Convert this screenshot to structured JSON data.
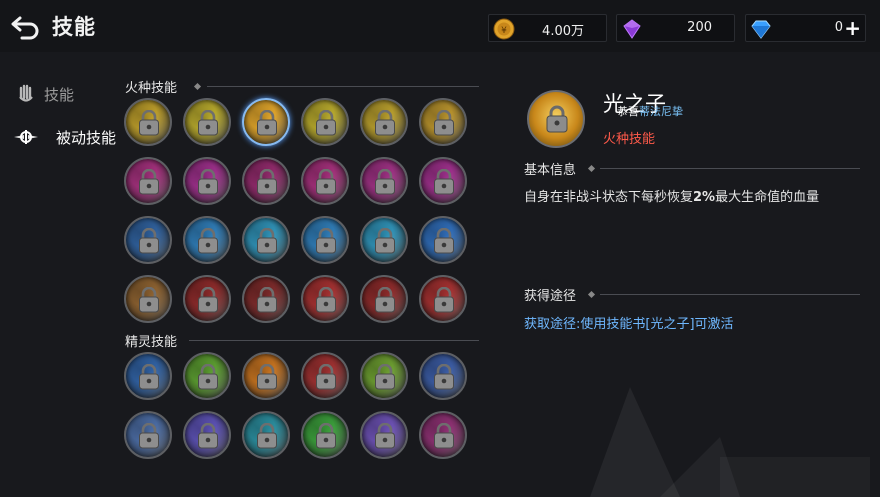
{
  "header": {
    "title": "技能"
  },
  "currencies": {
    "gold": {
      "value": "4.00万",
      "color": "#e0a32a"
    },
    "gem": {
      "value": "200",
      "color": "#8b3ad6"
    },
    "diamond": {
      "value": "0",
      "color": "#3aa0ff"
    }
  },
  "sidebar": {
    "items": [
      {
        "label": "技能",
        "icon": "fist-icon",
        "active": false
      },
      {
        "label": "被动技能",
        "icon": "winged-emblem-icon",
        "active": true
      }
    ]
  },
  "sections": {
    "fire": {
      "label": "火种技能"
    },
    "spirit": {
      "label": "精灵技能"
    }
  },
  "fire_skills": [
    [
      "#b89a2a",
      "#b3a52c",
      "#d9a02a",
      "#b3a52c",
      "#b39a2c",
      "#b38f2c"
    ],
    [
      "#a0307a",
      "#9a2f88",
      "#8f2a6a",
      "#a02f78",
      "#9a3080",
      "#9a2f88"
    ],
    [
      "#2f5f9a",
      "#2f7ab3",
      "#2f8fb3",
      "#2f7ab3",
      "#2f8fb3",
      "#2f6ab3"
    ],
    [
      "#8a6030",
      "#8a2a2a",
      "#7a2a2a",
      "#a03030",
      "#8a2a2a",
      "#a03030"
    ]
  ],
  "spirit_skills": [
    [
      "#3060a0",
      "#5a9a30",
      "#c07020",
      "#9a3030",
      "#6a9a30",
      "#3a5aa0"
    ],
    [
      "#4a6aa0",
      "#5a50b0",
      "#2a8a9a",
      "#3a9a3a",
      "#6a50b0",
      "#8a3070"
    ]
  ],
  "detail": {
    "name": "光之子",
    "overlay_white": "恭喜",
    "overlay_blue": "蒂法尼挚",
    "type": "火种技能",
    "basic_info_label": "基本信息",
    "description_pre": "自身在非战斗状态下每秒恢复",
    "description_bold": "2%",
    "description_post": "最大生命值的血量",
    "acquire_label": "获得途径",
    "acquire_text": "获取途径:使用技能书[光之子]可激活"
  }
}
